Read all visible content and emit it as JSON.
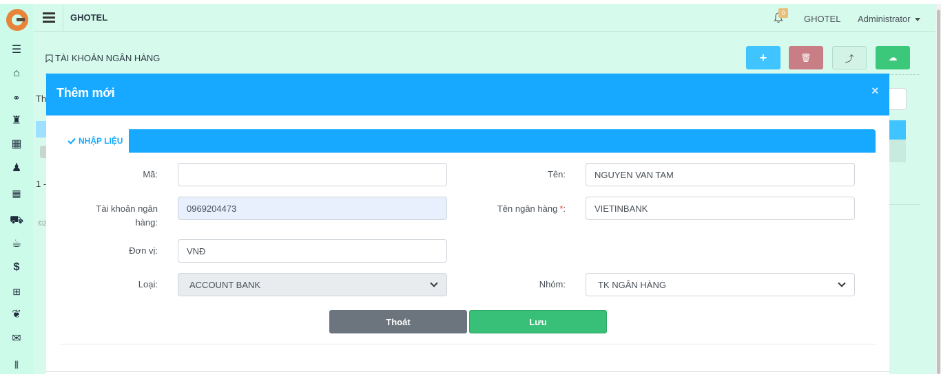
{
  "header": {
    "brand": "GHOTEL",
    "notification_count": "0",
    "hotel_label": "GHOTEL",
    "user_label": "Administrator"
  },
  "page": {
    "title": "TÀI KHOẢN NGÂN HÀNG"
  },
  "toolbar": {
    "add_icon": "+",
    "delete_icon": "🗑",
    "share_icon": "⤴",
    "download_icon": "☁"
  },
  "background": {
    "text_th": "Th",
    "text_pagination": "1 -",
    "text_copyright": "©2"
  },
  "modal": {
    "title": "Thêm mới",
    "close": "×",
    "tab_label": "NHẬP LIỆU",
    "fields": {
      "ma": {
        "label": "Mã:",
        "value": ""
      },
      "ten": {
        "label": "Tên:",
        "value": "NGUYEN VAN TAM"
      },
      "tai_khoan": {
        "label": "Tài khoản ngân hàng:",
        "value": "0969204473"
      },
      "ten_ngan_hang": {
        "label": "Tên ngân hàng",
        "required_mark": "*",
        "label_suffix": ":",
        "value": "VIETINBANK"
      },
      "don_vi": {
        "label": "Đơn vị:",
        "value": "VNĐ"
      },
      "loai": {
        "label": "Loại:",
        "value": "ACCOUNT BANK"
      },
      "nhom": {
        "label": "Nhóm:",
        "value": "TK NGÂN HÀNG"
      }
    },
    "buttons": {
      "exit": "Thoát",
      "save": "Lưu"
    }
  },
  "colors": {
    "primary": "#17a9ff",
    "success": "#38bf78",
    "secondary": "#6c757d",
    "danger_muted": "#c97e85",
    "page_bg": "#d6faec"
  }
}
